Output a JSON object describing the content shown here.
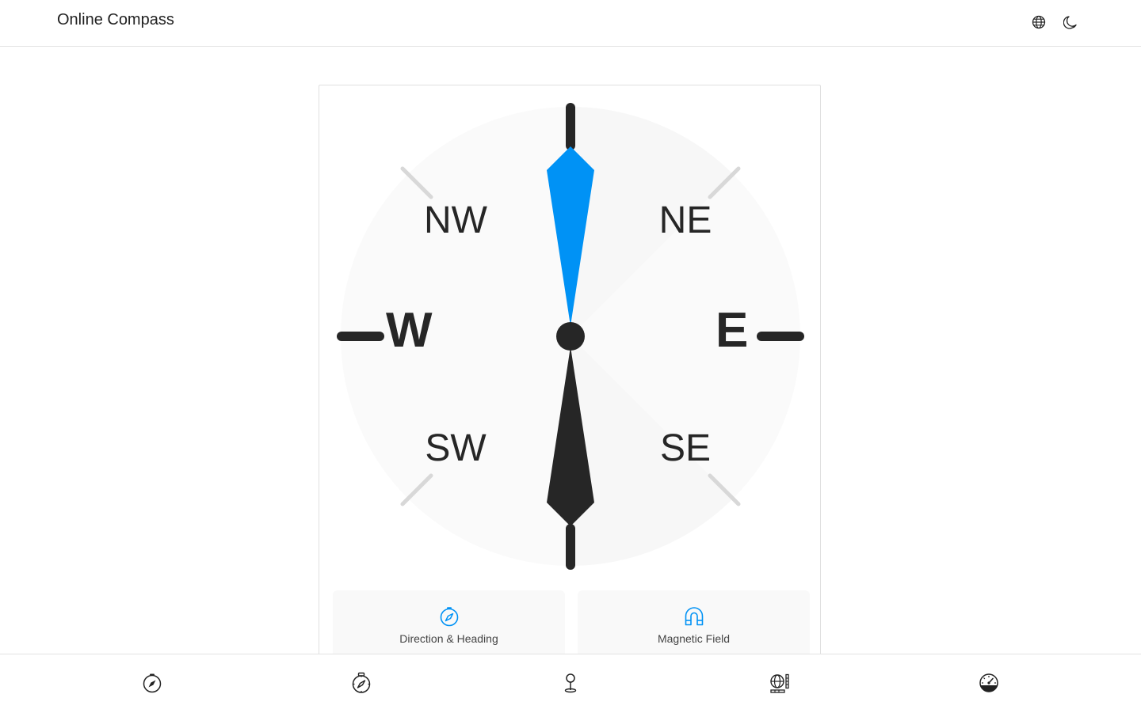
{
  "app": {
    "title": "Online Compass"
  },
  "header": {
    "language_icon": "globe-icon",
    "theme_icon": "moon-icon"
  },
  "compass": {
    "labels": {
      "west": "W",
      "east": "E",
      "northwest": "NW",
      "northeast": "NE",
      "southwest": "SW",
      "southeast": "SE"
    },
    "heading_degrees": 0
  },
  "tiles": [
    {
      "label": "Direction & Heading",
      "icon": "compass-icon"
    },
    {
      "label": "Magnetic Field",
      "icon": "magnet-icon"
    }
  ],
  "bottom_nav": {
    "items": [
      "compass-icon",
      "stopwatch-compass-icon",
      "location-pin-icon",
      "globe-tools-icon",
      "speedometer-icon"
    ]
  },
  "colors": {
    "accent": "#0092f5",
    "dark": "#262626",
    "muted_tick": "#d8d8d8",
    "dial_bg": "#fafafa"
  }
}
